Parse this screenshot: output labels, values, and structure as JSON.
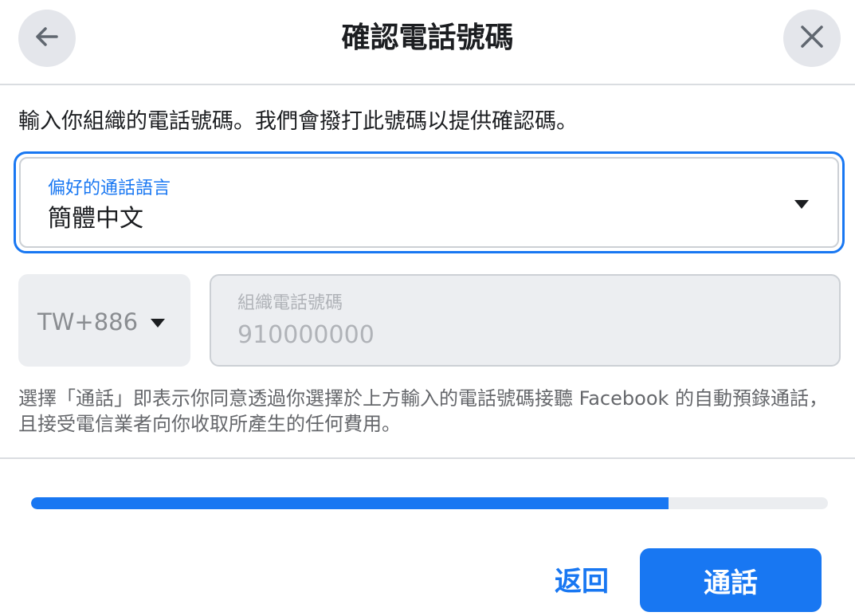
{
  "header": {
    "title": "確認電話號碼",
    "back_icon": "arrow-left-icon",
    "close_icon": "close-icon"
  },
  "instruction": "輸入你組織的電話號碼。我們會撥打此號碼以提供確認碼。",
  "language_select": {
    "label": "偏好的通話語言",
    "value": "簡體中文",
    "icon": "caret-down-icon"
  },
  "country_code": {
    "value": "TW+886",
    "icon": "caret-down-icon"
  },
  "phone_field": {
    "label": "組織電話號碼",
    "placeholder": "910000000",
    "value": ""
  },
  "disclaimer": "選擇「通話」即表示你同意透過你選擇於上方輸入的電話號碼接聽 Facebook 的自動預錄通話，且接受電信業者向你收取所產生的任何費用。",
  "progress": {
    "fraction": 0.8
  },
  "footer": {
    "back_label": "返回",
    "call_label": "通話"
  },
  "colors": {
    "accent": "#1877f2",
    "disabled_field": "#eceef1",
    "muted_text": "#65676b"
  }
}
